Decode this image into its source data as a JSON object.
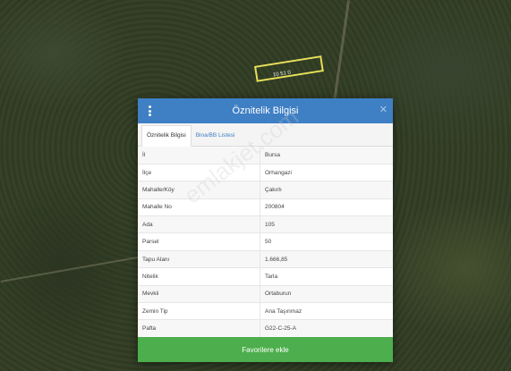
{
  "map": {
    "parcel_label": "10 51 0"
  },
  "dialog": {
    "title": "Öznitelik Bilgisi",
    "close_glyph": "✕",
    "tabs": [
      {
        "label": "Öznitelik Bilgisi",
        "active": true
      },
      {
        "label": "Bina/BB Listesi",
        "active": false
      }
    ],
    "rows": [
      {
        "key": "İl",
        "value": "Bursa"
      },
      {
        "key": "İlçe",
        "value": "Orhangazi"
      },
      {
        "key": "Mahalle/Köy",
        "value": "Çakırlı"
      },
      {
        "key": "Mahalle No",
        "value": "200804"
      },
      {
        "key": "Ada",
        "value": "105"
      },
      {
        "key": "Parsel",
        "value": "50"
      },
      {
        "key": "Tapu Alanı",
        "value": "1.666,85"
      },
      {
        "key": "Nitelik",
        "value": "Tarla"
      },
      {
        "key": "Mevkii",
        "value": "Ortaburun"
      },
      {
        "key": "Zemin Tip",
        "value": "Ana Taşınmaz"
      },
      {
        "key": "Pafta",
        "value": "G22-C-25-A"
      }
    ],
    "favorite_button": "Favorilere ekle"
  },
  "watermark": "emlakjet.com",
  "colors": {
    "header": "#3f7fc4",
    "button": "#4cae4c",
    "parcel_outline": "#e6e05a"
  }
}
